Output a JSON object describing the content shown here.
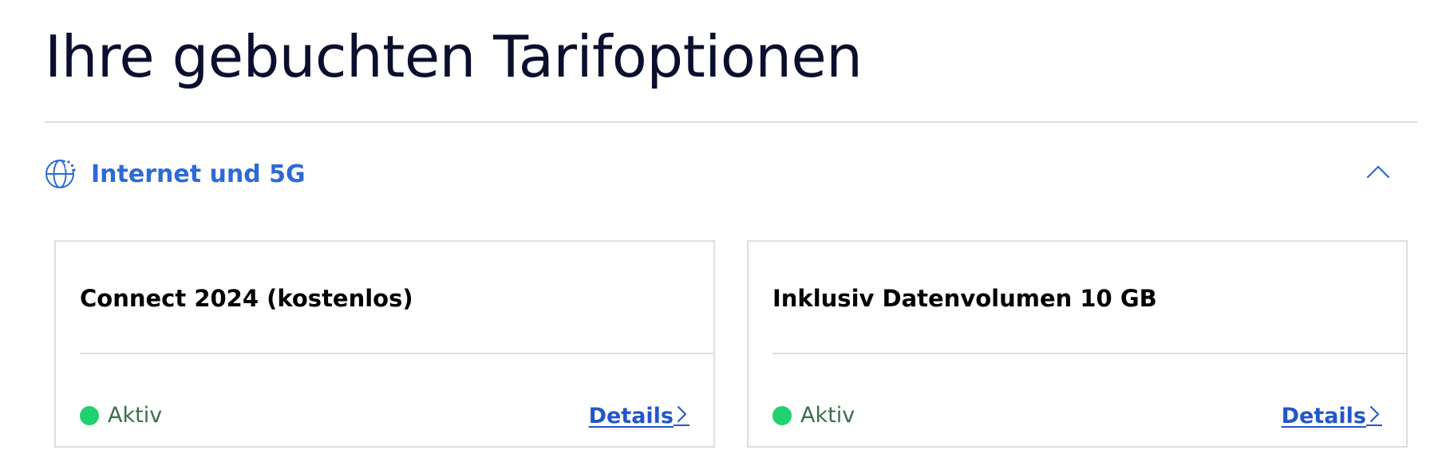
{
  "page": {
    "title": "Ihre gebuchten Tarifoptionen"
  },
  "section": {
    "title": "Internet und 5G",
    "icon": "globe-icon",
    "toggle_icon": "chevron-up-icon",
    "expanded": true
  },
  "cards": [
    {
      "title": "Connect 2024 (kostenlos)",
      "status": "Aktiv",
      "status_color": "#1fd16f",
      "link_label": "Details"
    },
    {
      "title": "Inklusiv Datenvolumen 10 GB",
      "status": "Aktiv",
      "status_color": "#1fd16f",
      "link_label": "Details"
    }
  ],
  "colors": {
    "accent": "#2d6ad6",
    "link": "#2356c8",
    "title": "#0b0f2e",
    "divider": "#dedede",
    "status_active": "#1fd16f"
  }
}
